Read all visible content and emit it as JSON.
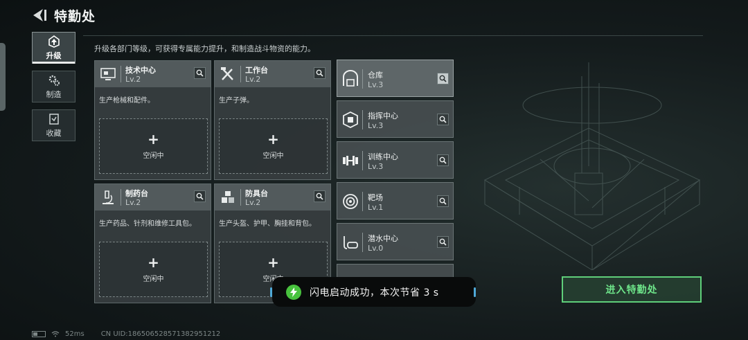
{
  "header": {
    "title": "特勤处",
    "subtitle": "升级各部门等级，可获得专属能力提升，和制造战斗物资的能力。"
  },
  "sidebar": {
    "tabs": [
      {
        "label": "升级",
        "icon": "upgrade-icon",
        "active": true
      },
      {
        "label": "制造",
        "icon": "gears-icon",
        "active": false
      },
      {
        "label": "收藏",
        "icon": "collection-icon",
        "active": false
      }
    ]
  },
  "departments": [
    {
      "name": "技术中心",
      "level": "Lv.2",
      "icon": "computer-icon",
      "desc": "生产枪械和配件。",
      "slot_plus": "+",
      "slot_label": "空闲中"
    },
    {
      "name": "工作台",
      "level": "Lv.2",
      "icon": "tools-icon",
      "desc": "生产子弹。",
      "slot_plus": "+",
      "slot_label": "空闲中"
    },
    {
      "name": "制药台",
      "level": "Lv.2",
      "icon": "microscope-icon",
      "desc": "生产药品、针剂和维修工具包。",
      "slot_plus": "+",
      "slot_label": "空闲中"
    },
    {
      "name": "防具台",
      "level": "Lv.2",
      "icon": "armor-cubes-icon",
      "desc": "生产头盔、护甲、胸挂和背包。",
      "slot_plus": "+",
      "slot_label": "空闲中"
    }
  ],
  "facilities": [
    {
      "name": "仓库",
      "level": "Lv.3",
      "icon": "warehouse-icon"
    },
    {
      "name": "指挥中心",
      "level": "Lv.3",
      "icon": "chip-icon"
    },
    {
      "name": "训练中心",
      "level": "Lv.3",
      "icon": "dumbbell-icon"
    },
    {
      "name": "靶场",
      "level": "Lv.1",
      "icon": "target-icon"
    },
    {
      "name": "潜水中心",
      "level": "Lv.0",
      "icon": "diving-mask-icon"
    }
  ],
  "enter_button": "进入特勤处",
  "toast": {
    "message": "闪电启动成功，本次节省 3 s"
  },
  "status": {
    "ping": "52ms",
    "uid": "CN UID:1865065285713829512​12"
  },
  "colors": {
    "accent_green": "#5fcf7a",
    "toast_icon_green": "#48c23e"
  }
}
